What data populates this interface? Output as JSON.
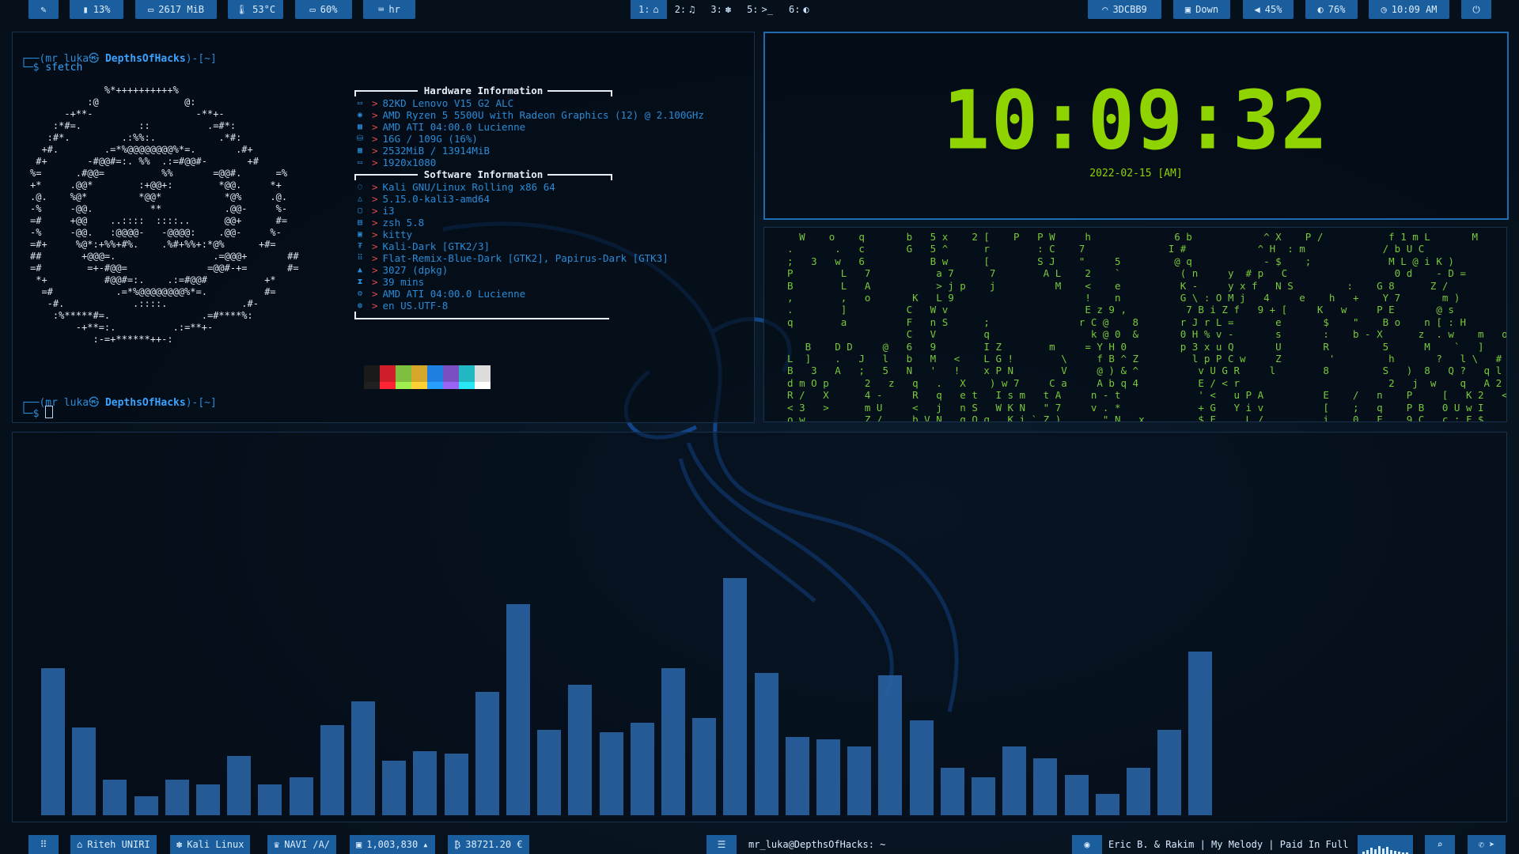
{
  "colors": {
    "accent": "#1b5e9e",
    "terminal_blue": "#2a8bd6",
    "arrow_red": "#e24a4a",
    "clock_green": "#8fd400",
    "matrix_green": "#79c83a"
  },
  "topbar": {
    "brush_icon": "paintbrush-icon",
    "cpu": "13%",
    "memory": "2617 MiB",
    "temp": "53°C",
    "battery": "60%",
    "keyboard": "hr",
    "workspaces": [
      {
        "num": "1:",
        "icon": "⌂"
      },
      {
        "num": "2:",
        "icon": "♫"
      },
      {
        "num": "3:",
        "icon": "✽"
      },
      {
        "num": "5:",
        "icon": ">_"
      },
      {
        "num": "6:",
        "icon": "◐"
      }
    ],
    "wifi": "3DCBB9",
    "ethernet": "Down",
    "volume": "45%",
    "brightness": "76%",
    "time": "10:09 AM"
  },
  "terminal": {
    "prompt_user": "(mr luka㉿ ",
    "prompt_host": "DepthsOfHacks",
    "prompt_path": ")-[~]",
    "command": "sfetch",
    "ascii_art": "             %*++++++++++%\n          :@               @:\n      -+**-                  -**+-\n    :*#=.          ::          .=#*:\n   :#*.         .:%%:.           .*#:\n  +#.        .=*%@@@@@@@@%*=.       .#+\n #+       -#@@#=:. %%  .:=#@@#-       +#\n%=      .#@@=          %%       =@@#.      =%\n+*     .@@*        :+@@+:        *@@.     *+\n.@.    %@*         *@@*           *@%     .@.\n-%     -@@.          **           .@@-     %-\n=#     +@@    ..::::  ::::..      @@+      #=\n-%     -@@.   :@@@@-   -@@@@:    .@@-     %-\n=#+     %@*:+%%+#%.    .%#+%%+:*@%      +#=\n##       +@@@=.                 .=@@@+       ##\n=#        =+-#@@=              =@@#-+=       #=\n *+          #@@#=:.    .:=#@@#          +*\n  =#           .=*%@@@@@@@@%*=.          #=\n   -#.            .::::.             .#-\n    :%*****#=.                .=#****%:\n        -+**=:.          .:=**+-\n           :-=+******++-:",
    "hardware_title": "Hardware Information",
    "software_title": "Software Information",
    "hardware": [
      {
        "icon": "laptop-icon",
        "glyph": "▭",
        "value": "82KD Lenovo V15 G2 ALC"
      },
      {
        "icon": "cpu-icon",
        "glyph": "◉",
        "value": "AMD Ryzen 5 5500U with Radeon Graphics (12) @ 2.100GHz"
      },
      {
        "icon": "gpu-icon",
        "glyph": "▩",
        "value": "AMD ATI 04:00.0 Lucienne"
      },
      {
        "icon": "disk-icon",
        "glyph": "⛁",
        "value": "16G / 109G (16%)"
      },
      {
        "icon": "memory-icon",
        "glyph": "▦",
        "value": "2532MiB / 13914MiB"
      },
      {
        "icon": "monitor-icon",
        "glyph": "▭",
        "value": "1920x1080"
      }
    ],
    "software": [
      {
        "icon": "os-icon",
        "glyph": "◌",
        "value": "Kali GNU/Linux Rolling x86 64"
      },
      {
        "icon": "kernel-icon",
        "glyph": "△",
        "value": "5.15.0-kali3-amd64"
      },
      {
        "icon": "wm-icon",
        "glyph": "▢",
        "value": "i3"
      },
      {
        "icon": "shell-icon",
        "glyph": "▤",
        "value": "zsh 5.8"
      },
      {
        "icon": "terminal-icon",
        "glyph": "▣",
        "value": "kitty"
      },
      {
        "icon": "theme-icon",
        "glyph": "₮",
        "value": "Kali-Dark [GTK2/3]"
      },
      {
        "icon": "icons-icon",
        "glyph": "⠿",
        "value": "Flat-Remix-Blue-Dark [GTK2], Papirus-Dark [GTK3]"
      },
      {
        "icon": "package-icon",
        "glyph": "▲",
        "value": "3027 (dpkg)"
      },
      {
        "icon": "uptime-icon",
        "glyph": "⧗",
        "value": "39 mins"
      },
      {
        "icon": "gpu-driver-icon",
        "glyph": "⚙",
        "value": "AMD ATI 04:00.0 Lucienne"
      },
      {
        "icon": "locale-icon",
        "glyph": "◍",
        "value": "en US.UTF-8"
      }
    ],
    "palette": [
      "#1a1a1a",
      "#d01d2a",
      "#7fbf3f",
      "#d4a629",
      "#1f7fe0",
      "#7a4fc2",
      "#22b9c4",
      "#dcdcdc"
    ]
  },
  "clock": {
    "time": "10:09:32",
    "date": "2022-02-15 [AM]"
  },
  "matrix": {
    "lines": [
      "    W    o    q       b   5 x    2 [    P   P W     h              6 b            ^ X    P /           f 1 m L       M          I",
      "  .       .   c       G   5 ^      r        : C    7              I #            ^ H  : m             / b U C                  j",
      "  ;   3   w   6           B w      [        S J    \"     5         @ q            - $    ;             M L @ i K )          w",
      "  P        L   7           a 7      7        A L    2    `          ( n     y  # p   C                  0 d    - D =         w",
      "  B        L   A           > j p    j          M    <    e          K -     y x f   N S         :    G 8      Z /           e",
      "  ,        ,   o       K   L 9                      !    n          G \\ : O M j   4     e    h   +    Y 7       m )          u",
      "  .        ]          C   W v                       E z 9 ,          7 B i Z f   9 + [     K   w     P E       @ s          K",
      "  q        a          F   n S      ;               r C @    8       r J r L =       e       $    \"    B o    n [ : H        V   ; F",
      "                      C   V        q                 k @ 0  &       0 H % v -       s       :    b - X      z  . w    m   o 9 [ H",
      "     B    D D     @   6   9        I Z        m     = Y H 0         p 3 x u Q       U       R         5      M    `   ]    0 V x -",
      "  L  ]    .   J   l   b   M   <    L G !        \\     f B ^ Z         l p P C w     Z        '         h       ?   l \\   # o 7 J [",
      "  B   3   A   ;   5   N   '   !    x P N        V     @ ) & ^          v U G R     l        8         S   )  8   Q ?   q l E d v \\",
      "  d m O p      2   z   q   .   X    ) w 7     C a     A b q 4          E / < r                         2   j  w    q   A 2 ? N 9 k",
      "  R /   X      4 -     R   q   e t   I s m   t A     n - t             ' <   u P A          E    /   n    P     [   K 2   <   K",
      "  < 3   >      m U     <   j   n S   W K N   \" 7     v . *             + G   Y i v          [    ;   q    P B   0 U w I       ^",
      "  o w          Z /     b V N   q O q . K i ` Z )       \" N   x         $ F     L /          i    0   F    9 C   c ; F $       &"
    ]
  },
  "visualizer": {
    "levels": [
      0.62,
      0.37,
      0.15,
      0.08,
      0.15,
      0.13,
      0.25,
      0.13,
      0.16,
      0.38,
      0.48,
      0.23,
      0.27,
      0.26,
      0.52,
      0.89,
      0.36,
      0.55,
      0.35,
      0.39,
      0.62,
      0.41,
      1.0,
      0.6,
      0.33,
      0.32,
      0.29,
      0.59,
      0.4,
      0.2,
      0.16,
      0.29,
      0.24,
      0.17,
      0.09,
      0.2,
      0.36,
      0.69
    ]
  },
  "bottombar": {
    "grid_icon": "grid-icon",
    "university": "Riteh UNIRI",
    "distro": "Kali Linux",
    "trophy": "NAVI /A/",
    "stock": "1,003,830",
    "btc": "38721.20 €",
    "window_title": "mr_luka@DepthsOfHacks: ~",
    "now_playing": "Eric B. & Rakim | My Melody | Paid In Full",
    "search_icon": "search-icon",
    "tray_icon": "viber-icon"
  }
}
